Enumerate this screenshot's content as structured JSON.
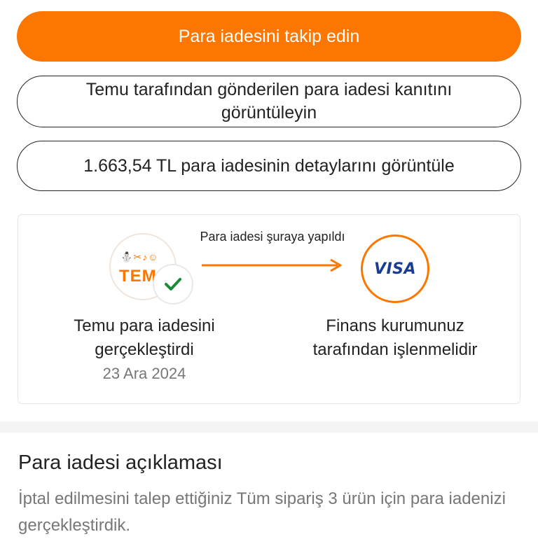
{
  "actions": {
    "track_refund": "Para iadesini takip edin",
    "view_proof": "Temu tarafından gönderilen para iadesi kanıtını görüntüleyin",
    "view_details": "1.663,54 TL para iadesinin detaylarını görüntüle"
  },
  "refund_flow": {
    "arrow_caption": "Para iadesi şuraya yapıldı",
    "source": {
      "logo_glyphs": "⛄✂♪☺",
      "logo_text": "TEM",
      "status": "Temu para iadesini gerçekleştirdi",
      "date": "23 Ara 2024"
    },
    "destination": {
      "card_brand": "VISA",
      "status": "Finans kurumunuz tarafından işlenmelidir"
    }
  },
  "explanation": {
    "title": "Para iadesi açıklaması",
    "body": "İptal edilmesini talep ettiğiniz Tüm sipariş 3 ürün için para iadenizi gerçekleştirdik."
  },
  "colors": {
    "accent": "#fb7701",
    "success": "#1a8a3a",
    "visa_blue": "#1a3d8f"
  },
  "icons": {
    "check": "check-icon",
    "arrow": "arrow-right-icon"
  }
}
